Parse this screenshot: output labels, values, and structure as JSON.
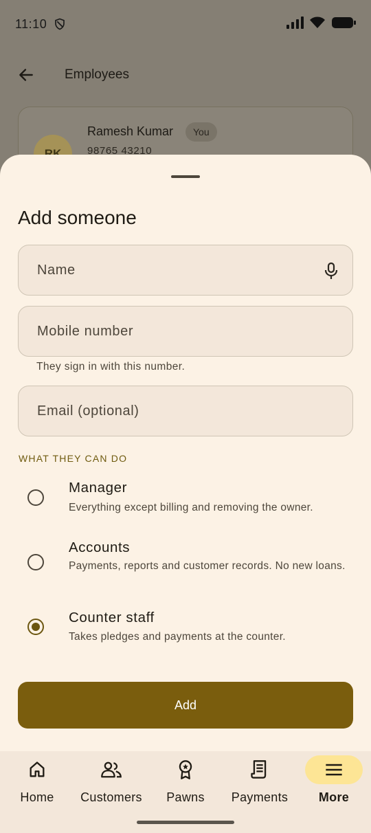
{
  "status_bar": {
    "time": "11:10",
    "icons": [
      "shield-icon",
      "signal-icon",
      "wifi-icon",
      "battery-icon"
    ]
  },
  "app_bar": {
    "back_icon": "arrow-left-icon",
    "title": "Employees"
  },
  "employee_card": {
    "initials": "RK",
    "name": "Ramesh Kumar",
    "badge": "You",
    "phone": "98765 43210"
  },
  "sheet": {
    "title": "Add someone",
    "name_field": {
      "placeholder": "Name",
      "value": "",
      "trailing_icon": "mic-icon"
    },
    "mobile_field": {
      "placeholder": "Mobile number",
      "value": "",
      "helper": "They sign in with this number."
    },
    "email_field": {
      "placeholder": "Email (optional)",
      "value": ""
    },
    "section_label": "WHAT THEY CAN DO",
    "roles": [
      {
        "title": "Manager",
        "description": "Everything except billing and removing the owner.",
        "selected": false
      },
      {
        "title": "Accounts",
        "description": "Payments, reports and customer records. No new loans.",
        "selected": false
      },
      {
        "title": "Counter staff",
        "description": "Takes pledges and payments at the counter.",
        "selected": true
      }
    ],
    "add_label": "Add"
  },
  "bottom_nav": {
    "items": [
      {
        "label": "Home",
        "icon": "home-icon",
        "active": false
      },
      {
        "label": "Customers",
        "icon": "customers-icon",
        "active": false
      },
      {
        "label": "Pawns",
        "icon": "pawns-badge-icon",
        "active": false
      },
      {
        "label": "Payments",
        "icon": "receipt-icon",
        "active": false
      },
      {
        "label": "More",
        "icon": "menu-icon",
        "active": true
      }
    ]
  },
  "colors": {
    "accent": "#7a5d0d",
    "sheet_background": "#fcf2e5",
    "scrim_background": "#857f74",
    "active_nav_pill": "#fde595"
  }
}
